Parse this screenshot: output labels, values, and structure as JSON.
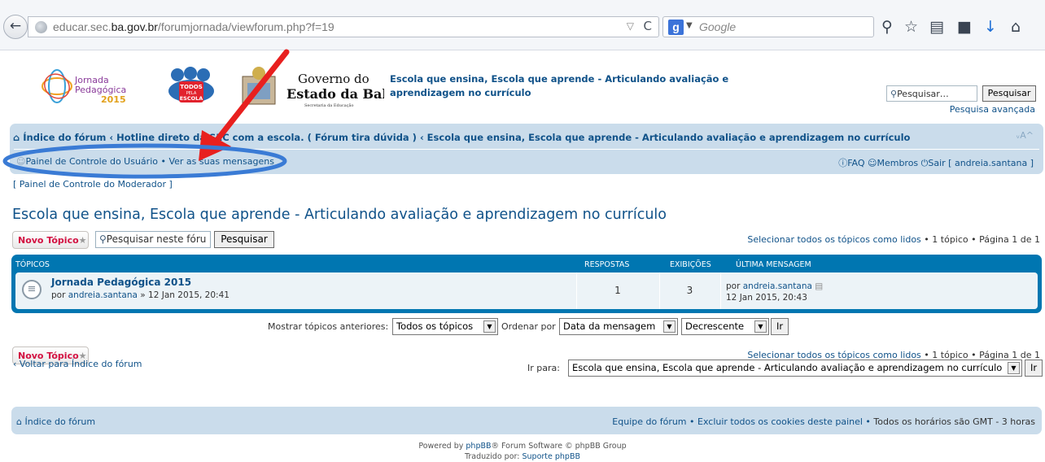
{
  "browser": {
    "url_prefix": "educar.sec.",
    "url_domain": "ba.gov.br",
    "url_path": "/forumjornada/viewforum.php?f=19",
    "search_engine": "Google"
  },
  "header": {
    "jornada_logo": "Jornada Pedagógica 2015",
    "todos_logo": "TODOS PELA ESCOLA",
    "gov_logo_line1": "Governo do",
    "gov_logo_line2": "Estado da Bahia",
    "gov_logo_sub": "Secretaria da Educação",
    "title": "Escola que ensina, Escola que aprende - Articulando avaliação e aprendizagem no currículo",
    "search_placeholder": "Pesquisar…",
    "search_button": "Pesquisar",
    "advanced_search": "Pesquisa avançada"
  },
  "nav": {
    "breadcrumbs": "Índice do fórum ‹ Hotline direto da SEC com a escola. ( Fórum tira dúvida ) ‹ Escola que ensina, Escola que aprende - Articulando avaliação e aprendizagem no currículo",
    "font_size_ctrl": "ᵥA^",
    "ucp": "Painel de Controle do Usuário",
    "messages": "Ver as suas mensagens",
    "faq": "FAQ",
    "members": "Membros",
    "logout": "Sair [ andreia.santana ]",
    "mcp": "[ Painel de Controle do Moderador ]"
  },
  "forum": {
    "title": "Escola que ensina, Escola que aprende - Articulando avaliação e aprendizagem no currículo",
    "new_topic": "Novo Tópico",
    "search_value": "Pesquisar neste fóru",
    "search_button": "Pesquisar",
    "mark_read": "Selecionar todos os tópicos como lidos",
    "topic_count": "1 tópico",
    "page_info": "Página 1 de 1"
  },
  "table": {
    "headers": {
      "topics": "TÓPICOS",
      "replies": "RESPOSTAS",
      "views": "EXIBIÇÕES",
      "last_post": "ÚLTIMA MENSAGEM"
    },
    "rows": [
      {
        "title": "Jornada Pedagógica 2015",
        "by_prefix": "por",
        "author": "andreia.santana",
        "date": "» 12 Jan 2015, 20:41",
        "replies": "1",
        "views": "3",
        "last_prefix": "por",
        "last_author": "andreia.santana",
        "last_date": "12 Jan 2015, 20:43"
      }
    ]
  },
  "sort": {
    "show_label": "Mostrar tópicos anteriores:",
    "show_value": "Todos os tópicos",
    "order_label": "Ordenar por",
    "order_value": "Data da mensagem",
    "direction_value": "Decrescente",
    "go_button": "Ir"
  },
  "bottom": {
    "back_link": "Voltar para Índice do fórum",
    "jump_label": "Ir para:",
    "jump_value": "Escola que ensina, Escola que aprende - Articulando avaliação e aprendizagem no currículo",
    "jump_button": "Ir"
  },
  "footer": {
    "index": "Índice do fórum",
    "team": "Equipe do fórum",
    "cookies": "Excluir todos os cookies deste painel",
    "timezone": "Todos os horários são GMT - 3 horas",
    "powered_by": "Powered by",
    "phpbb": "phpBB",
    "powered_rest": "® Forum Software © phpBB Group",
    "translated_by": "Traduzido por:",
    "translator": "Suporte phpBB"
  },
  "colors": {
    "link": "#105289",
    "navbar": "#cadceb",
    "table_header": "#0076b1",
    "new_topic": "#d31141",
    "annotation": "#e8201f",
    "ellipse": "#3a7bd5"
  }
}
